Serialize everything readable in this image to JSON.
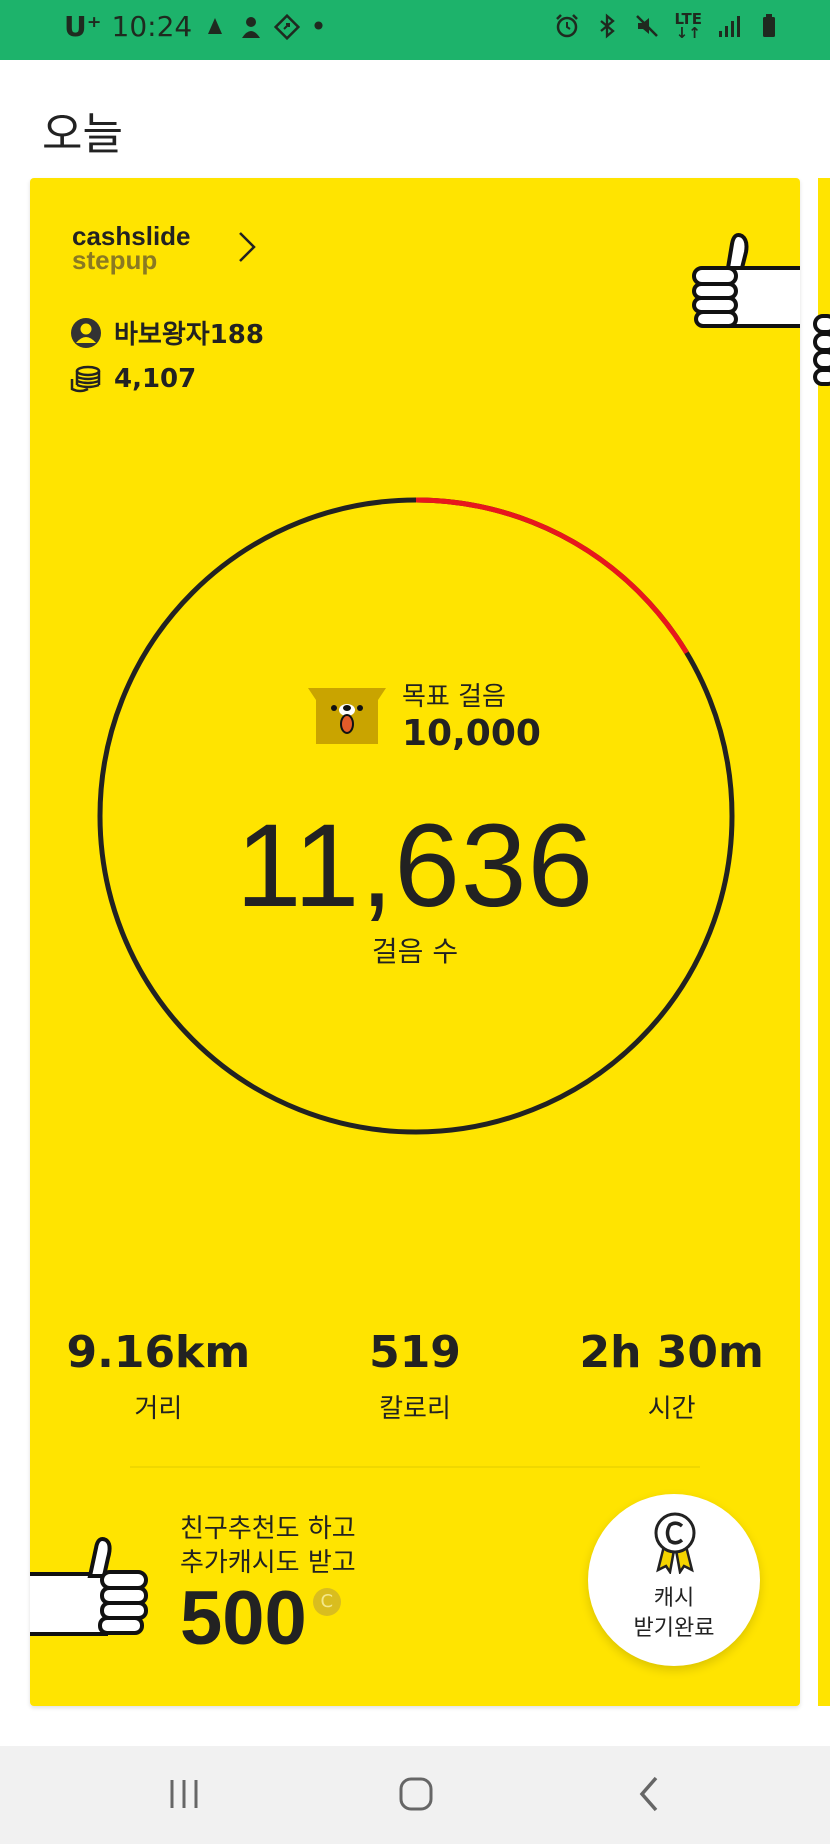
{
  "status_bar": {
    "carrier": "U⁺",
    "time": "10:24",
    "dot": "•",
    "lte_top": "LTE",
    "lte_bottom": "↓↑"
  },
  "header": {
    "title": "오늘"
  },
  "card": {
    "brand_line1": "cashslide",
    "brand_line2": "stepup",
    "username": "바보왕자188",
    "coins": "4,107",
    "goal_label": "목표 걸음",
    "goal_value": "10,000",
    "steps": "11,636",
    "steps_label": "걸음 수",
    "steps_progress": 1.1636,
    "stats": [
      {
        "value": "9.16km",
        "label": "거리"
      },
      {
        "value": "519",
        "label": "칼로리"
      },
      {
        "value": "2h 30m",
        "label": "시간"
      }
    ],
    "promo_line1": "친구추천도 하고",
    "promo_line2": "추가캐시도 받고",
    "promo_amount": "500",
    "coin_symbol": "C",
    "cash_button_line1": "캐시",
    "cash_button_line2": "받기완료"
  },
  "colors": {
    "status_bar": "#1db36b",
    "card": "#ffe400",
    "ring": "#222222",
    "ring_progress": "#e8171c"
  }
}
